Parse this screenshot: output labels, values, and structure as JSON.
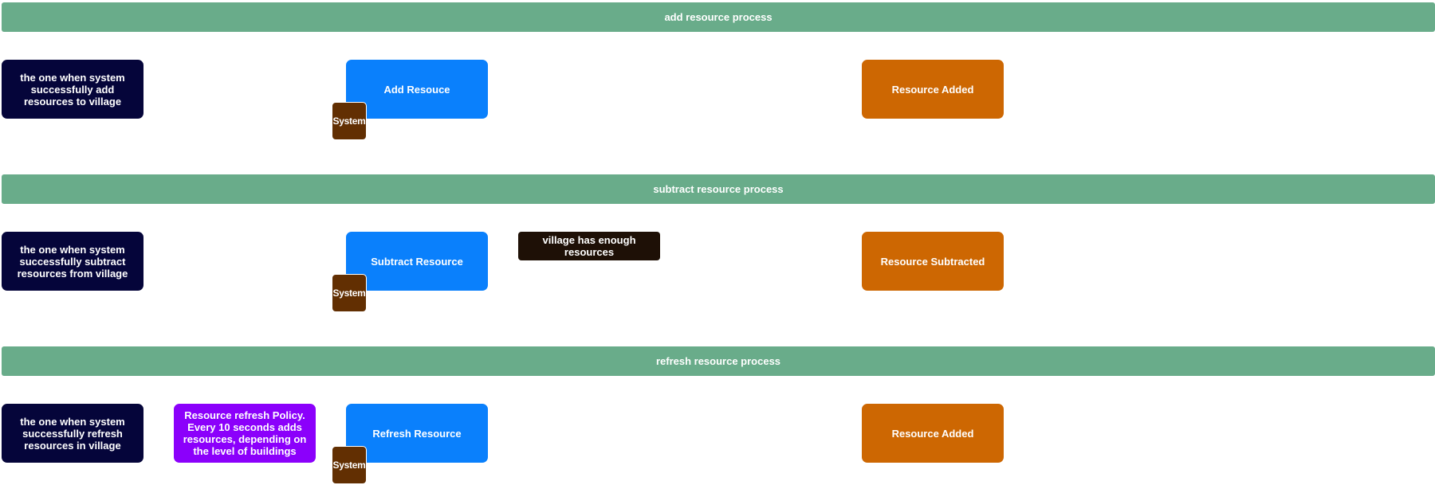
{
  "lanes": [
    {
      "title": "add resource process",
      "note": "the one when system successfully add resources to village",
      "command": "Add Resouce",
      "actor": "System",
      "event": "Resource Added"
    },
    {
      "title": "subtract resource process",
      "note": "the one when system successfully subtract resources from village",
      "command": "Subtract Resource",
      "actor": "System",
      "condition": "village has enough resources",
      "event": "Resource Subtracted"
    },
    {
      "title": "refresh resource process",
      "note": "the one when system successfully refresh resources in village",
      "policy": "Resource refresh Policy. Every 10 seconds adds resources, depending on the level of buildings",
      "command": "Refresh Resource",
      "actor": "System",
      "event": "Resource Added"
    }
  ],
  "colors": {
    "lane_header": "#69ac8a",
    "note": "#05053a",
    "command": "#0a80fc",
    "event": "#cd6702",
    "actor": "#622f02",
    "policy": "#8b00fb",
    "condition": "#1e1006"
  }
}
